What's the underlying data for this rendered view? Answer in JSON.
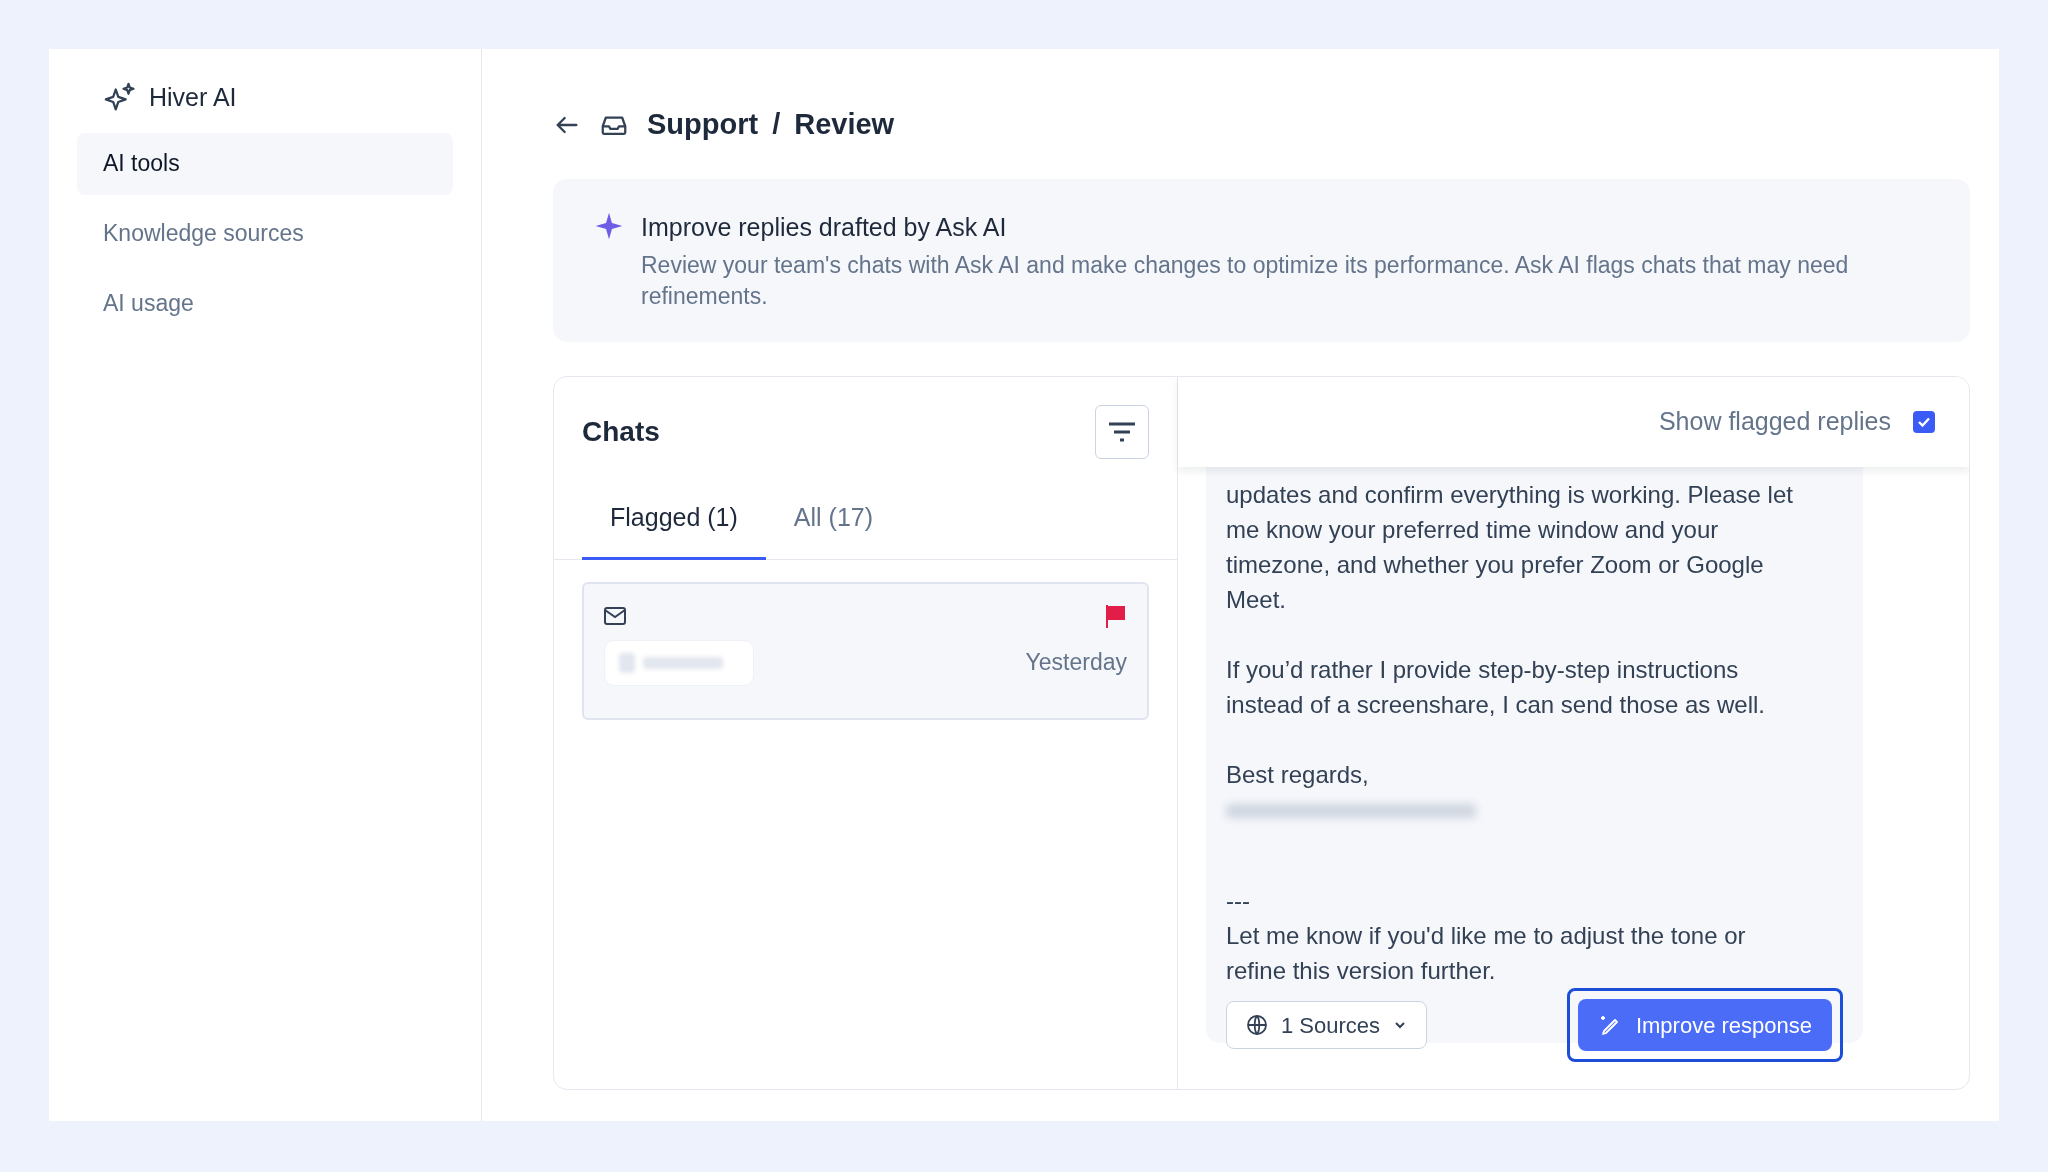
{
  "sidebar": {
    "brand": "Hiver AI",
    "items": [
      {
        "label": "AI tools",
        "selected": true
      },
      {
        "label": "Knowledge sources",
        "selected": false
      },
      {
        "label": "AI usage",
        "selected": false
      }
    ]
  },
  "breadcrumb": [
    "Support",
    "/",
    "Review"
  ],
  "banner": {
    "title": "Improve replies drafted by Ask AI",
    "text": "Review your team's chats with Ask AI and make changes to optimize its performance. Ask AI flags chats that may need refinements."
  },
  "chats": {
    "title": "Chats",
    "tabs": [
      {
        "label": "Flagged (1)",
        "selected": true
      },
      {
        "label": "All (17)",
        "selected": false
      }
    ],
    "items": [
      {
        "flagged": true,
        "time": "Yesterday"
      }
    ]
  },
  "reply": {
    "show_flagged": {
      "label": "Show flagged replies",
      "checked": true
    },
    "paragraphs": [
      {
        "kind": "text",
        "text": "updates and confirm everything is working. Please let me know your preferred time window and your timezone, and whether you prefer Zoom or Google Meet."
      },
      {
        "kind": "text",
        "text": "If you’d rather I provide step-by-step instructions instead of a screenshare, I can send those as well."
      },
      {
        "kind": "signature",
        "text": "Best regards,"
      },
      {
        "kind": "text",
        "text": "---\nLet me know if you'd like me to adjust the tone or refine this version further."
      }
    ],
    "sources": "1 Sources",
    "improve": "Improve response"
  }
}
